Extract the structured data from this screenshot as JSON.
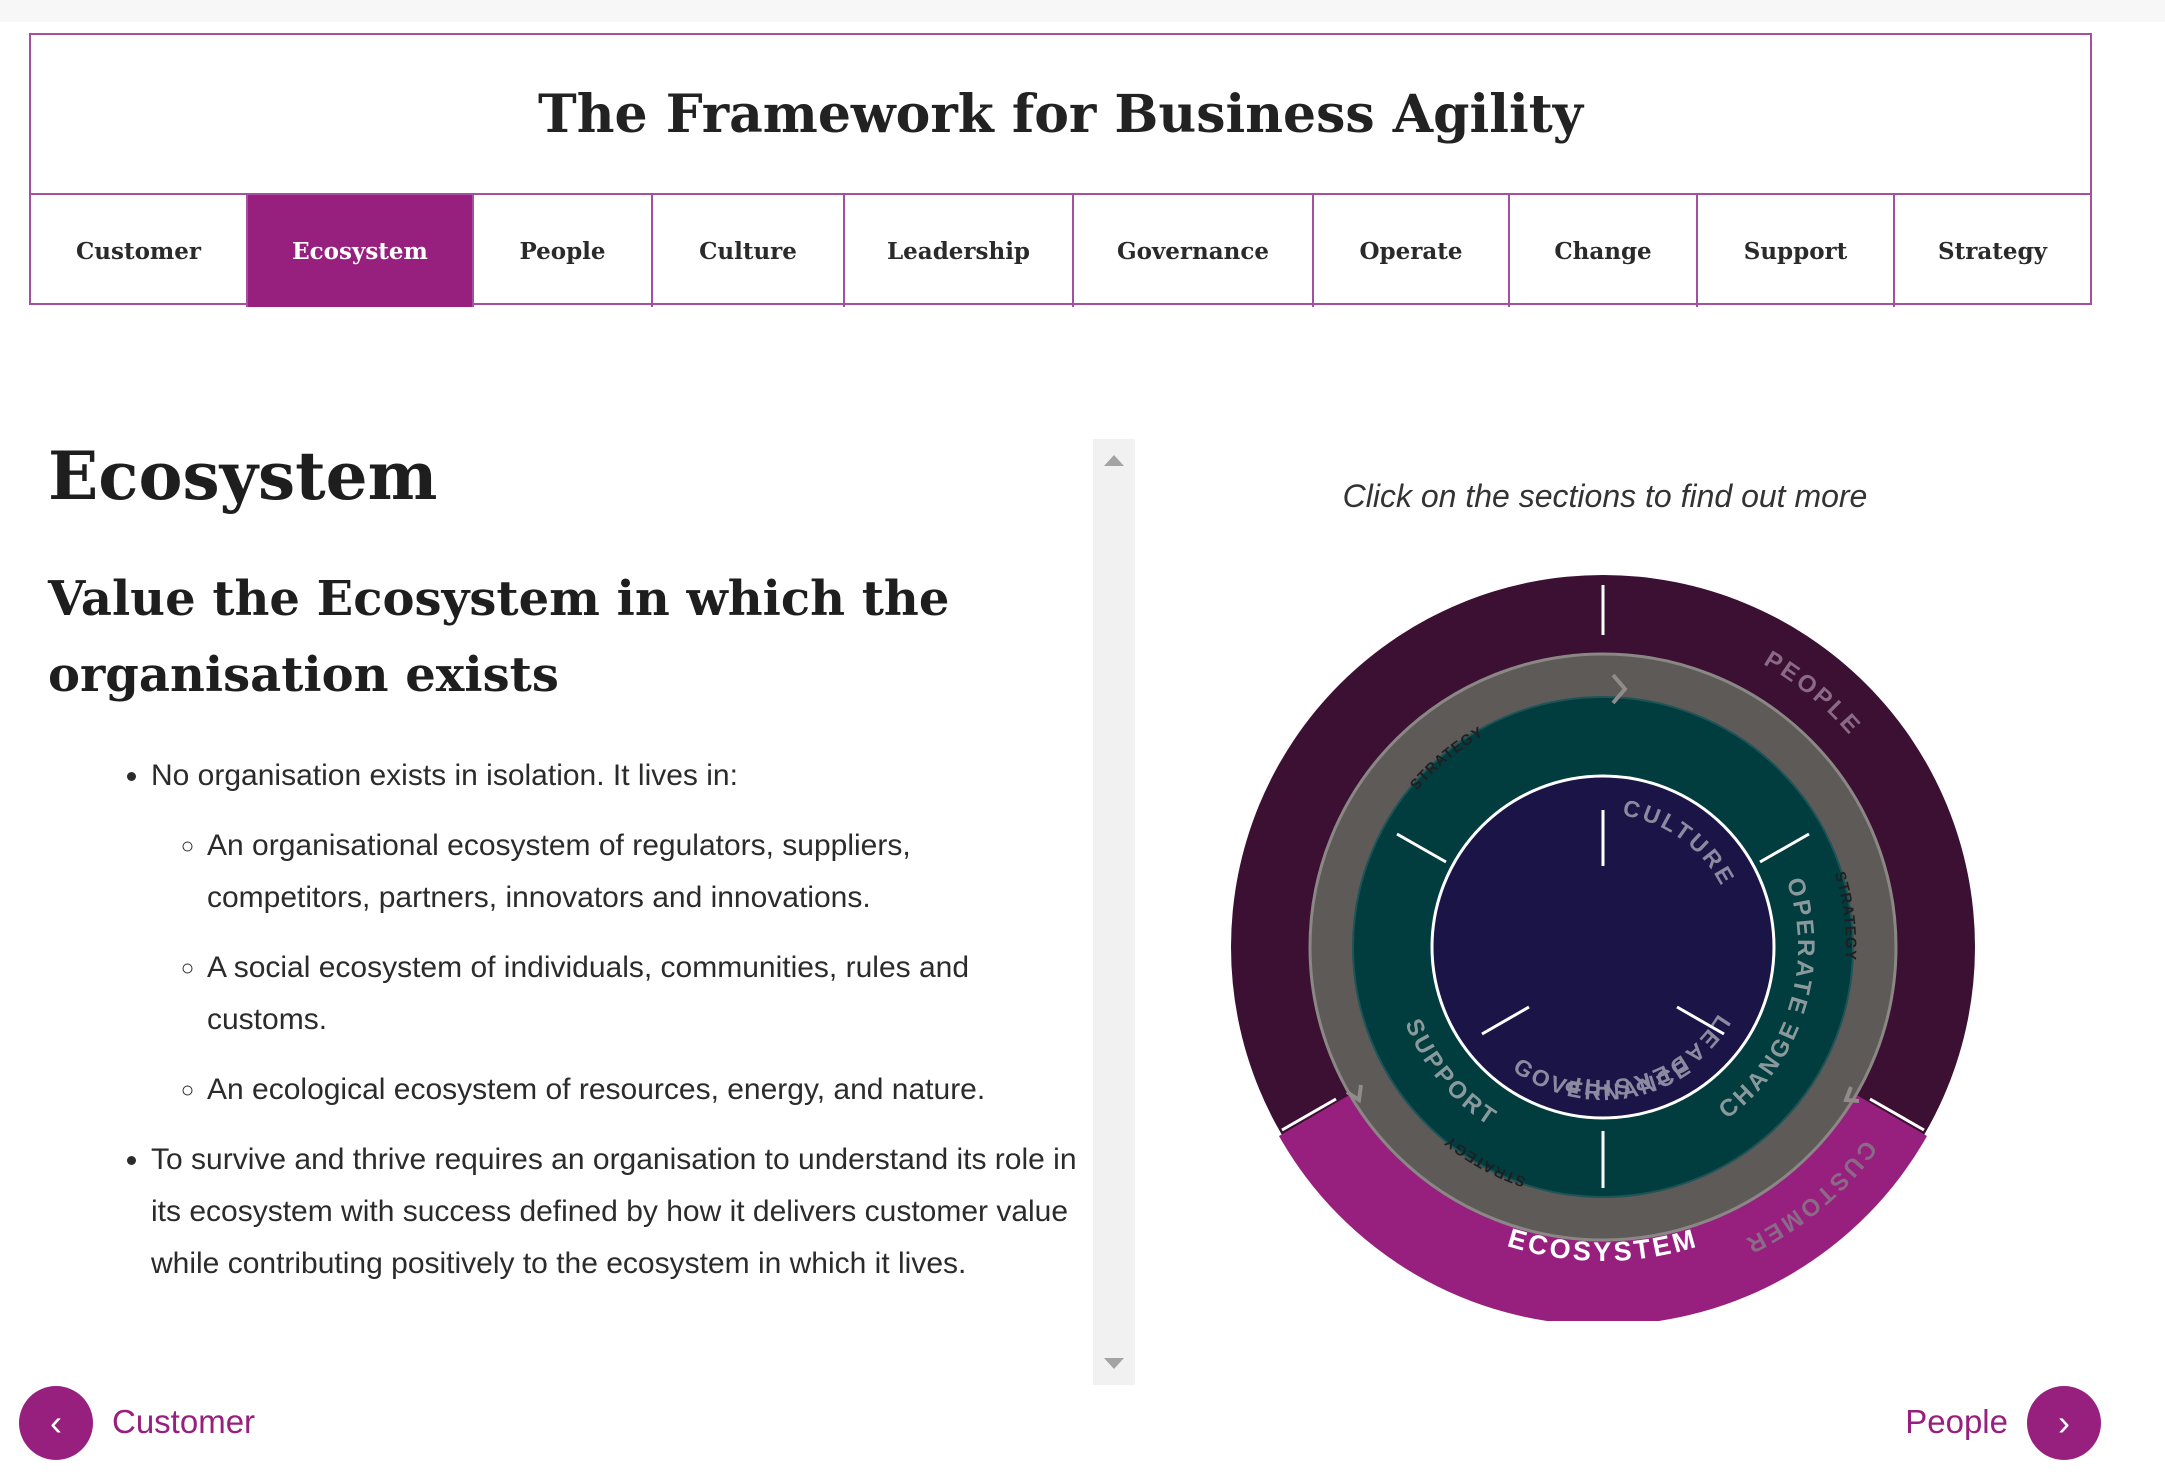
{
  "header": {
    "title": "The Framework for Business Agility",
    "tabs": [
      {
        "label": "Customer",
        "active": false
      },
      {
        "label": "Ecosystem",
        "active": true
      },
      {
        "label": "People",
        "active": false
      },
      {
        "label": "Culture",
        "active": false
      },
      {
        "label": "Leadership",
        "active": false
      },
      {
        "label": "Governance",
        "active": false
      },
      {
        "label": "Operate",
        "active": false
      },
      {
        "label": "Change",
        "active": false
      },
      {
        "label": "Support",
        "active": false
      },
      {
        "label": "Strategy",
        "active": false
      }
    ]
  },
  "content": {
    "heading": "Ecosystem",
    "subheading": "Value the Ecosystem in which the organisation exists",
    "bullet1": "No organisation exists in isolation. It lives in:",
    "sub_bullets": [
      "An organisational ecosystem of regulators, suppliers, competitors, partners, innovators and innovations.",
      "A social ecosystem of individuals, communities, rules and customs.",
      "An ecological ecosystem of resources, energy, and nature."
    ],
    "bullet2": "To survive and thrive requires an organisation to understand its role in its ecosystem with success defined by how it delivers customer value while contributing positively to the ecosystem in which it lives."
  },
  "diagram": {
    "hint": "Click on the sections to find out more",
    "outer_labels": [
      "PEOPLE",
      "CUSTOMER",
      "ECOSYSTEM"
    ],
    "strategy_label": "STRATEGY",
    "middle_labels": [
      "OPERATE",
      "SUPPORT",
      "CHANGE"
    ],
    "inner_labels": [
      "CULTURE",
      "LEADERSHIP",
      "GOVERNANCE"
    ],
    "colors": {
      "outer": "#3b1032",
      "ecosystem": "#97207f",
      "strategy_ring": "#5d5a57",
      "middle": "#013c3f",
      "inner": "#1b1547"
    }
  },
  "nav": {
    "prev_label": "Customer",
    "next_label": "People",
    "prev_icon": "chevron-left-icon",
    "next_icon": "chevron-right-icon"
  }
}
